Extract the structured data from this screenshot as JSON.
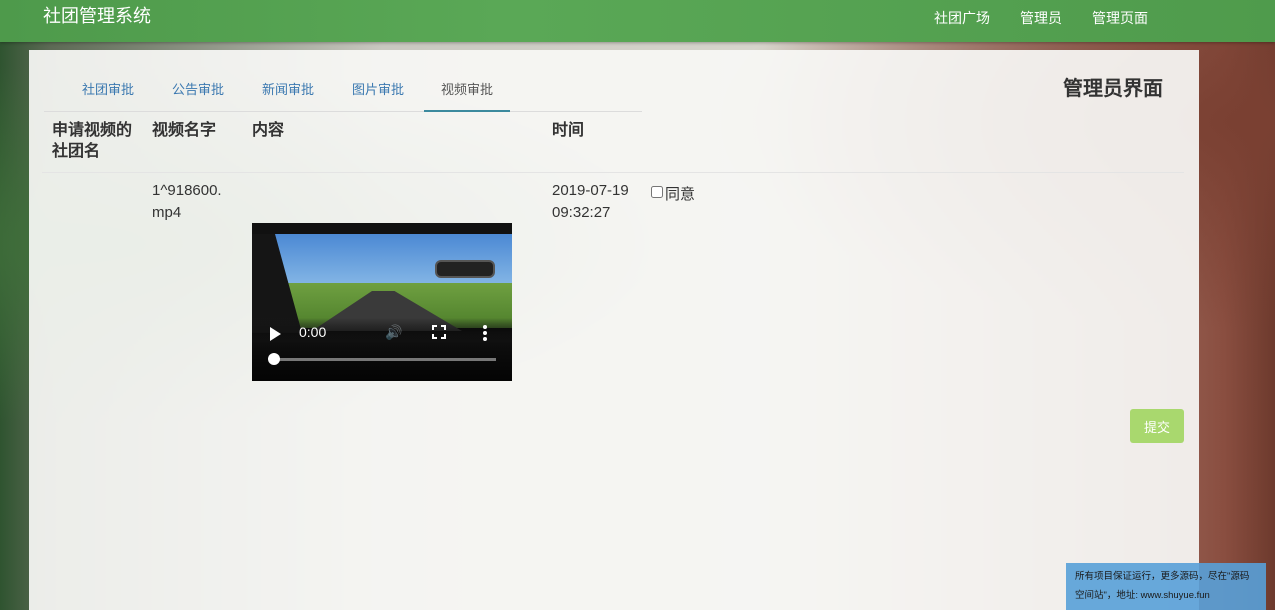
{
  "navbar": {
    "brand": "社团管理系统",
    "links": [
      "社团广场",
      "管理员",
      "管理页面"
    ]
  },
  "panel": {
    "title": "管理员界面",
    "tabs": [
      {
        "label": "社团审批",
        "active": false
      },
      {
        "label": "公告审批",
        "active": false
      },
      {
        "label": "新闻审批",
        "active": false
      },
      {
        "label": "图片审批",
        "active": false
      },
      {
        "label": "视频审批",
        "active": true
      }
    ],
    "table": {
      "headers": [
        "申请视频的社团名",
        "视频名字",
        "内容",
        "时间"
      ],
      "rows": [
        {
          "club_name": "",
          "video_name": "1^918600.mp4",
          "video_time": "0:00",
          "time": "2019-07-19 09:32:27",
          "agree_label": "同意",
          "agree_checked": false
        }
      ]
    },
    "submit_label": "提交"
  },
  "footer_note": {
    "line1": "所有项目保证运行，更多源码，尽在\"源码",
    "line2": "空间站\"，地址: www.shuyue.fun"
  },
  "colors": {
    "navbar": "#5aa856",
    "submit": "#a9d86e",
    "tab_text": "#3a78b0",
    "active_tab_border": "#3c8a9e"
  }
}
